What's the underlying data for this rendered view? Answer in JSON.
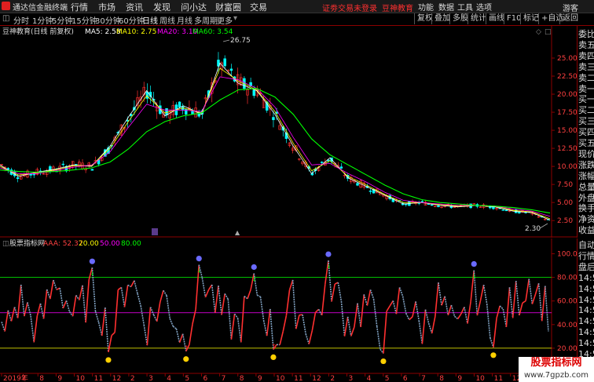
{
  "app": {
    "name": "通达信金融终端"
  },
  "menu": [
    "行情",
    "市场",
    "资讯",
    "发现",
    "问小达",
    "财富圈",
    "交易"
  ],
  "notice": "证劵交易未登录",
  "account": "豆神教育",
  "right_menu": [
    "功能",
    "数据",
    "工具",
    "选项"
  ],
  "guest": "游客",
  "periods": [
    "分时",
    "1分钟",
    "5分钟",
    "15分钟",
    "30分钟",
    "60分钟",
    "日线",
    "周线",
    "月线",
    "多周期",
    "更多"
  ],
  "active_period": "日线",
  "right_buttons": [
    "复权",
    "叠加",
    "多股",
    "统计",
    "画线",
    "F10",
    "标记",
    "+自选",
    "返回"
  ],
  "main_legend": {
    "title": "豆神教育(日线 前复权)",
    "items": [
      {
        "label": "MA5: 2.58",
        "color": "#ffffff"
      },
      {
        "label": "MA10: 2.75",
        "color": "#ffff00"
      },
      {
        "label": "MA20: 3.10",
        "color": "#ff00ff"
      },
      {
        "label": "MA60: 3.54",
        "color": "#00ff00"
      }
    ]
  },
  "sub_legend": {
    "title": "股票指标网",
    "items": [
      {
        "label": "AAA: 52.37",
        "color": "#ff4040"
      },
      {
        "label": "20.00",
        "color": "#ffff00"
      },
      {
        "label": "50.00",
        "color": "#ff00ff"
      },
      {
        "label": "80.00",
        "color": "#00ff00"
      }
    ]
  },
  "price_axis": [
    "25.00",
    "22.50",
    "20.00",
    "17.50",
    "15.00",
    "12.50",
    "10.00",
    "7.50",
    "5.00",
    "2.50"
  ],
  "indicator_axis": [
    "100.0",
    "80.00",
    "60.00",
    "40.00",
    "20.00"
  ],
  "high_label": "26.75",
  "low_label": "2.30",
  "date_axis": [
    "2019年",
    "7",
    "8",
    "9",
    "10",
    "11",
    "12",
    "2",
    "3",
    "4",
    "5",
    "6",
    "7",
    "8",
    "9",
    "10",
    "11",
    "12",
    "2",
    "3",
    "4",
    "5",
    "6",
    "7",
    "8",
    "9",
    "10",
    "11",
    "12",
    "2",
    "3"
  ],
  "right_panel_top": [
    "委比",
    "卖五",
    "卖四",
    "卖三",
    "卖二",
    "卖一",
    "买一",
    "买二",
    "买三",
    "买四",
    "买五",
    "现价",
    "涨跌",
    "涨幅",
    "总量",
    "外盘",
    "换手",
    "净资",
    "收益"
  ],
  "right_panel_bottom": [
    "自动",
    "行情",
    "盘后",
    "14:5",
    "14:5",
    "14:5",
    "14:5",
    "14:5",
    "14:5",
    "14:5",
    "14:5"
  ],
  "watermark": {
    "title": "股票指标网",
    "url": "www.7gpzb.com"
  },
  "colors": {
    "bull": "#ff3030",
    "bear": "#00ffff",
    "ma5": "#ffffff",
    "ma10": "#ffff00",
    "ma20": "#ff00ff",
    "ma60": "#00ff00",
    "axis": "#8b0000"
  },
  "chart_data": [
    {
      "type": "line",
      "title": "豆神教育(日线 前复权)",
      "ylim": [
        2.3,
        26.75
      ],
      "x": [
        "2019年",
        "7",
        "8",
        "9",
        "10",
        "11",
        "12",
        "2",
        "3",
        "4",
        "5",
        "6",
        "7",
        "8",
        "9",
        "10",
        "11",
        "12",
        "2",
        "3",
        "4",
        "5",
        "6",
        "7",
        "8",
        "9",
        "10",
        "11",
        "12",
        "2",
        "3"
      ],
      "series": [
        {
          "name": "MA5",
          "values": [
            10.2,
            8.6,
            9.2,
            9.6,
            10.2,
            10.0,
            12.8,
            16.8,
            20.5,
            17.0,
            18.4,
            17.2,
            24.3,
            21.5,
            20.5,
            17.2,
            12.8,
            9.0,
            11.2,
            8.4,
            7.2,
            6.0,
            4.8,
            5.0,
            4.6,
            4.4,
            4.6,
            4.4,
            3.8,
            3.6,
            2.58
          ]
        },
        {
          "name": "MA10",
          "values": [
            10.0,
            8.8,
            9.1,
            9.5,
            10.1,
            10.1,
            12.5,
            16.2,
            19.8,
            17.4,
            18.1,
            17.4,
            23.6,
            21.8,
            20.6,
            17.6,
            13.2,
            9.4,
            10.8,
            8.6,
            7.4,
            6.1,
            5.0,
            5.0,
            4.7,
            4.5,
            4.6,
            4.5,
            3.9,
            3.7,
            2.75
          ]
        },
        {
          "name": "MA20",
          "values": [
            9.8,
            9.0,
            9.0,
            9.4,
            9.9,
            10.2,
            12.0,
            15.4,
            18.6,
            17.8,
            17.8,
            17.6,
            22.4,
            22.0,
            20.8,
            18.2,
            14.0,
            10.2,
            10.4,
            9.0,
            7.8,
            6.4,
            5.3,
            5.0,
            4.8,
            4.6,
            4.6,
            4.5,
            4.1,
            3.8,
            3.1
          ]
        },
        {
          "name": "MA60",
          "values": [
            9.5,
            9.3,
            9.2,
            9.3,
            9.5,
            9.8,
            10.6,
            12.4,
            14.8,
            16.2,
            17.0,
            17.4,
            19.2,
            20.6,
            20.8,
            19.6,
            17.2,
            13.8,
            11.6,
            10.2,
            8.8,
            7.4,
            6.2,
            5.4,
            5.0,
            4.8,
            4.6,
            4.5,
            4.3,
            4.0,
            3.54
          ]
        }
      ]
    },
    {
      "type": "line",
      "title": "股票指标网",
      "ylim": [
        0,
        100
      ],
      "x": [
        "2019年",
        "7",
        "8",
        "9",
        "10",
        "11",
        "12",
        "2",
        "3",
        "4",
        "5",
        "6",
        "7",
        "8",
        "9",
        "10",
        "11",
        "12",
        "2",
        "3",
        "4",
        "5",
        "6",
        "7",
        "8",
        "9",
        "10",
        "11",
        "12",
        "2",
        "3"
      ],
      "series": [
        {
          "name": "AAA",
          "values": [
            28,
            62,
            35,
            80,
            45,
            70,
            30,
            85,
            40,
            65,
            25,
            82,
            50,
            38,
            72,
            26,
            60,
            34,
            80,
            42,
            58,
            30,
            66,
            36,
            62,
            28,
            70,
            40,
            55,
            80,
            52.37
          ]
        }
      ],
      "reference_lines": [
        20,
        50,
        80
      ]
    }
  ]
}
